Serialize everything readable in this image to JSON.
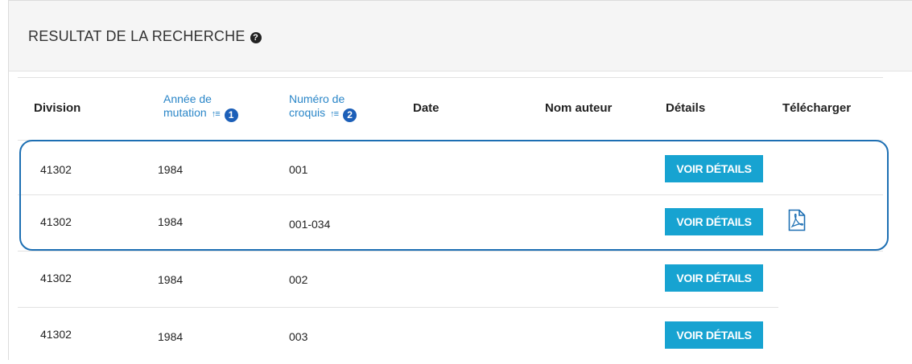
{
  "panel": {
    "title": "RESULTAT DE LA RECHERCHE",
    "help_icon": "question-circle-icon"
  },
  "table": {
    "headers": {
      "division": "Division",
      "annee_line1": "Année de",
      "annee_line2": "mutation",
      "annee_sort_order": "1",
      "numero_line1": "Numéro de",
      "numero_line2": "croquis",
      "numero_sort_order": "2",
      "date": "Date",
      "auteur": "Nom auteur",
      "details": "Détails",
      "telecharger": "Télécharger"
    },
    "sort_icon": "sort-ascending-icon",
    "rows": [
      {
        "division": "41302",
        "annee": "1984",
        "numero": "001",
        "date": "",
        "auteur": "",
        "details_label": "VOIR DÉTAILS",
        "has_pdf": false
      },
      {
        "division": "41302",
        "annee": "1984",
        "numero": "001-034",
        "date": "",
        "auteur": "",
        "details_label": "VOIR DÉTAILS",
        "has_pdf": true
      },
      {
        "division": "41302",
        "annee": "1984",
        "numero": "002",
        "date": "",
        "auteur": "",
        "details_label": "VOIR DÉTAILS",
        "has_pdf": false
      },
      {
        "division": "41302",
        "annee": "1984",
        "numero": "003",
        "date": "",
        "auteur": "",
        "details_label": "VOIR DÉTAILS",
        "has_pdf": false
      }
    ],
    "pdf_icon": "pdf-file-icon"
  },
  "colors": {
    "accent_link": "#2a86c8",
    "button": "#17a3d1",
    "highlight_border": "#1d6fb3",
    "sort_badge": "#1c5fb8"
  }
}
